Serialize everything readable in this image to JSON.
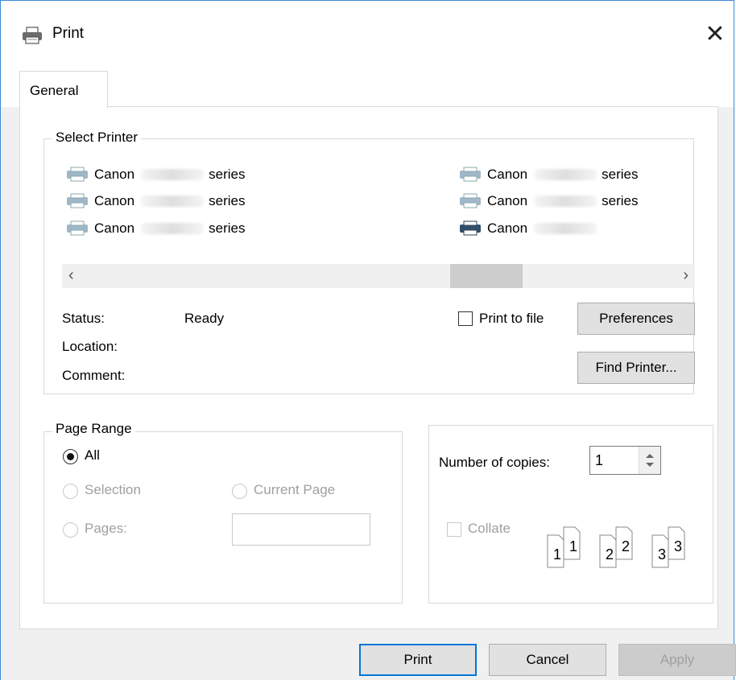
{
  "window": {
    "title": "Print"
  },
  "tabs": [
    {
      "label": "General"
    }
  ],
  "select_printer": {
    "legend": "Select Printer",
    "printers": [
      {
        "brand": "Canon",
        "suffix": "series"
      },
      {
        "brand": "Canon",
        "suffix": "series"
      },
      {
        "brand": "Canon",
        "suffix": "series"
      },
      {
        "brand": "Canon",
        "suffix": "series"
      },
      {
        "brand": "Canon",
        "suffix": "series"
      },
      {
        "brand": "Canon",
        "suffix": ""
      }
    ],
    "status_label": "Status:",
    "status_value": "Ready",
    "location_label": "Location:",
    "comment_label": "Comment:",
    "print_to_file_label": "Print to file",
    "preferences_label": "Preferences",
    "find_printer_label": "Find Printer..."
  },
  "page_range": {
    "legend": "Page Range",
    "all_label": "All",
    "selection_label": "Selection",
    "current_page_label": "Current Page",
    "pages_label": "Pages:",
    "pages_value": ""
  },
  "copies": {
    "number_label": "Number of copies:",
    "number_value": "1",
    "collate_label": "Collate",
    "collate_pages": [
      "1",
      "1",
      "2",
      "2",
      "3",
      "3"
    ]
  },
  "buttons": {
    "print": "Print",
    "cancel": "Cancel",
    "apply": "Apply"
  },
  "colors": {
    "window_border": "#3c8ad6",
    "default_button_border": "#0078d7",
    "scroll_thumb": "#cdcdcd"
  }
}
